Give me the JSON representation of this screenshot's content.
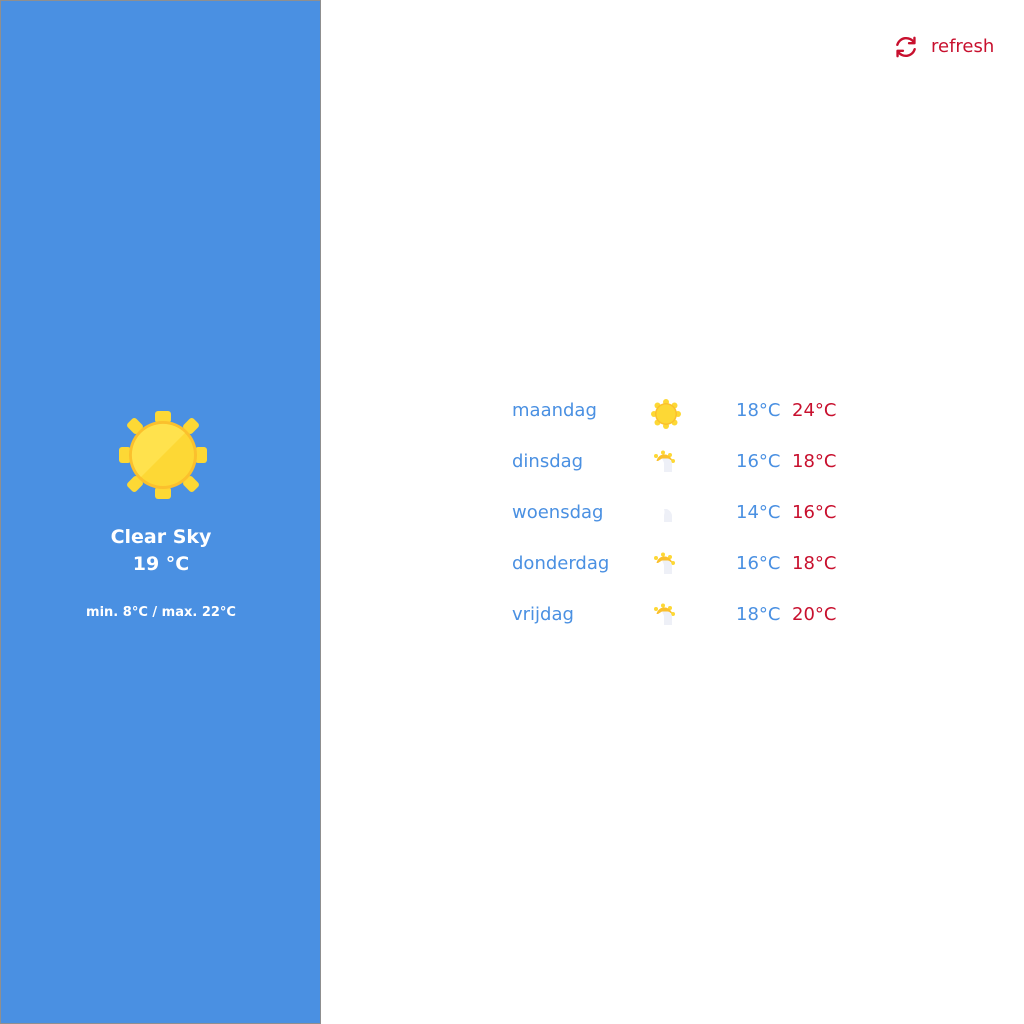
{
  "colors": {
    "sidebar_bg": "#4a90e2",
    "accent_blue": "#4a90e2",
    "accent_red": "#c8102e",
    "sun_yellow": "#fdd835"
  },
  "current": {
    "icon": "sun-icon",
    "description": "Clear Sky",
    "temperature": "19 °C",
    "minmax": "min. 8°C / max. 22°C"
  },
  "refresh": {
    "icon": "refresh-icon",
    "label": "refresh"
  },
  "forecast": [
    {
      "day": "maandag",
      "icon": "sun-icon",
      "min": "18°C",
      "max": "24°C"
    },
    {
      "day": "dinsdag",
      "icon": "partly-cloudy-icon",
      "min": "16°C",
      "max": "18°C"
    },
    {
      "day": "woensdag",
      "icon": "cloud-icon",
      "min": "14°C",
      "max": "16°C"
    },
    {
      "day": "donderdag",
      "icon": "partly-cloudy-icon",
      "min": "16°C",
      "max": "18°C"
    },
    {
      "day": "vrijdag",
      "icon": "partly-cloudy-icon",
      "min": "18°C",
      "max": "20°C"
    }
  ]
}
